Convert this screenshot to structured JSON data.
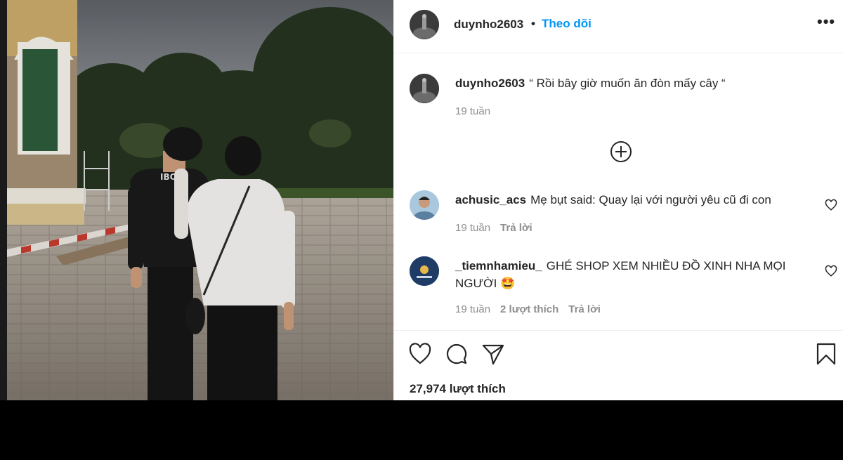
{
  "post": {
    "author": "duynho2603",
    "separator": "•",
    "follow_label": "Theo dõi",
    "more_label": "•••",
    "caption": {
      "username": "duynho2603",
      "text": "“ Rồi bây giờ muốn ăn đòn mấy cây “",
      "time": "19 tuần"
    },
    "load_more_icon": "plus-circle-icon"
  },
  "comments": [
    {
      "username": "achusic_acs",
      "text": "Mẹ bụt said: Quay lại với người yêu cũ đi con",
      "time": "19 tuần",
      "likes": "",
      "reply_label": "Trả lời"
    },
    {
      "username": "_tiemnhamieu_",
      "text": "GHÉ SHOP XEM NHIỀU ĐỒ XINH NHA MỌI NGƯỜI 🤩",
      "time": "19 tuần",
      "likes": "2 lượt thích",
      "reply_label": "Trả lời"
    }
  ],
  "actions": {
    "icons": [
      "heart-icon",
      "comment-icon",
      "share-icon",
      "bookmark-icon"
    ],
    "likes_text": "27,974 lượt thích"
  },
  "colors": {
    "accent": "#0095f6",
    "text": "#262626",
    "muted": "#8e8e8e",
    "border": "#efefef"
  }
}
